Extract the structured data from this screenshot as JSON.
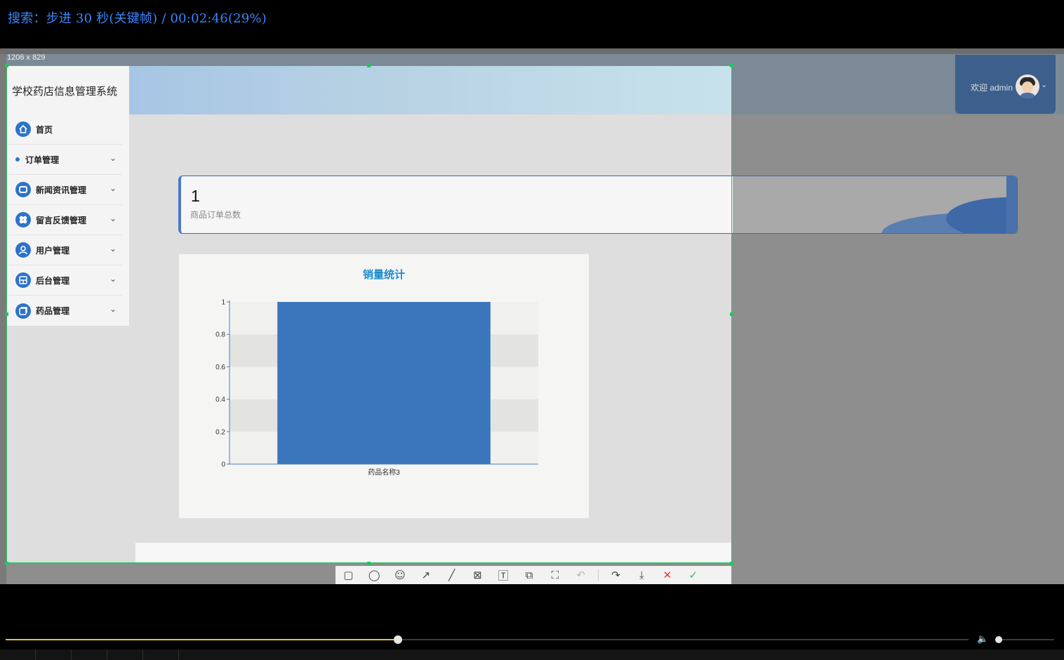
{
  "osd": {
    "text": "搜索：步进 30 秒(关键帧) / 00:02:46(29%)"
  },
  "capture": {
    "size_label": "1206 x 829"
  },
  "app": {
    "brand": "学校药店信息管理系统",
    "welcome": "欢迎 admin",
    "menu": [
      {
        "label": "首页",
        "icon": "home-icon"
      },
      {
        "label": "订单管理",
        "icon": "dot-icon"
      },
      {
        "label": "新闻资讯管理",
        "icon": "news-icon"
      },
      {
        "label": "留言反馈管理",
        "icon": "feedback-icon"
      },
      {
        "label": "用户管理",
        "icon": "user-icon"
      },
      {
        "label": "后台管理",
        "icon": "admin-icon"
      },
      {
        "label": "药品管理",
        "icon": "medicine-icon"
      }
    ],
    "stat": {
      "value": "1",
      "label": "商品订单总数"
    },
    "accent": "#2c73c9"
  },
  "chart_data": {
    "type": "bar",
    "title": "销量统计",
    "categories": [
      "药品名称3"
    ],
    "values": [
      1
    ],
    "ylim": [
      0,
      1
    ],
    "yticks": [
      "0",
      "0.2",
      "0.4",
      "0.6",
      "0.8",
      "1"
    ],
    "bar_color": "#3b76bd",
    "grid": "banded"
  },
  "toolbar": {
    "tools": [
      "rectangle-icon",
      "ellipse-icon",
      "emoji-icon",
      "arrow-icon",
      "line-icon",
      "mosaic-icon",
      "text-icon",
      "pin-icon",
      "ocr-icon",
      "undo-icon",
      "share-icon",
      "download-icon",
      "cancel-icon",
      "confirm-icon"
    ]
  },
  "player": {
    "progress_fraction": 0.29,
    "volume_fraction": 0.06
  }
}
